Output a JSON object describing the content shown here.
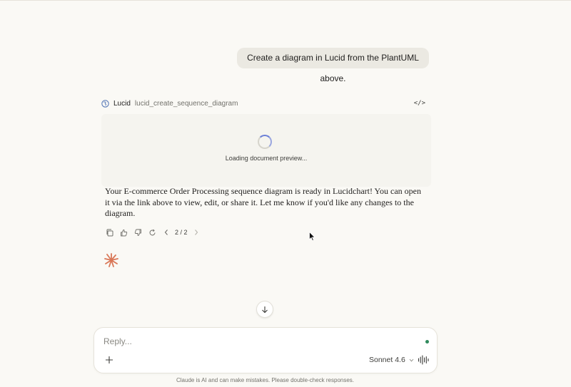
{
  "conversation": {
    "user_message": "Create a diagram in Lucid from the PlantUML above.",
    "tool_call": {
      "app_name": "Lucid",
      "function_name": "lucid_create_sequence_diagram",
      "icon": "globe-icon",
      "toggle_icon": "code-icon",
      "loading_text": "Loading document preview..."
    },
    "assistant_message": "Your E-commerce Order Processing sequence diagram is ready in Lucidchart! You can open it via the link above to view, edit, or share it. Let me know if you'd like any changes to the diagram.",
    "actions": {
      "copy": "copy-icon",
      "thumbs_up": "thumbs-up-icon",
      "thumbs_down": "thumbs-down-icon",
      "retry": "retry-icon",
      "version": "2 / 2"
    }
  },
  "composer": {
    "placeholder": "Reply...",
    "model": "Sonnet 4.6",
    "add_icon": "plus-icon",
    "voice_icon": "voice-waveform-icon"
  },
  "footer": {
    "disclaimer": "Claude is AI and can make mistakes. Please double-check responses."
  },
  "colors": {
    "background": "#faf9f5",
    "claude_accent": "#d97757",
    "status_green": "#2f8a5c",
    "spinner_blue": "#6b7fd7"
  }
}
